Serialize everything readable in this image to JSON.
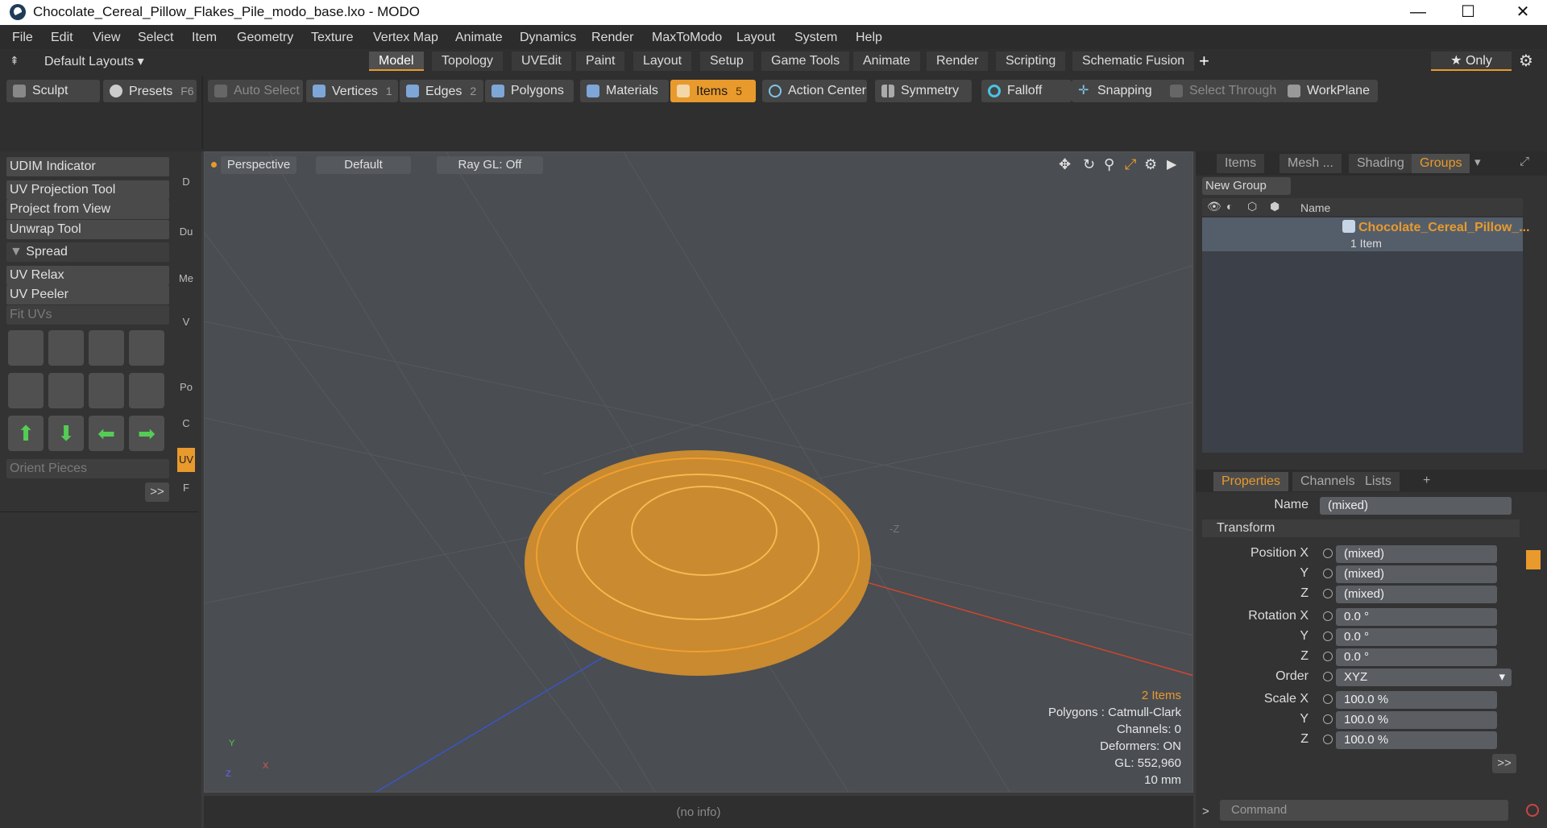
{
  "window": {
    "title": "Chocolate_Cereal_Pillow_Flakes_Pile_modo_base.lxo - MODO",
    "minimize": "—",
    "maximize": "☐",
    "close": "✕"
  },
  "menubar": [
    "File",
    "Edit",
    "View",
    "Select",
    "Item",
    "Geometry",
    "Texture",
    "Vertex Map",
    "Animate",
    "Dynamics",
    "Render",
    "MaxToModo",
    "Layout",
    "System",
    "Help"
  ],
  "layoutbar": {
    "layouts_dropdown": "Default Layouts",
    "tabs": [
      "Model",
      "Topology",
      "UVEdit",
      "Paint",
      "Layout",
      "Setup",
      "Game Tools",
      "Animate",
      "Render",
      "Scripting",
      "Schematic Fusion"
    ],
    "active_tab": "Model",
    "add": "+",
    "only": "★  Only"
  },
  "toolbar": {
    "sculpt": "Sculpt",
    "presets": "Presets",
    "presets_key": "F6",
    "auto_select": "Auto Select",
    "vertices": "Vertices",
    "vertices_count": "1",
    "edges": "Edges",
    "edges_count": "2",
    "polygons": "Polygons",
    "materials": "Materials",
    "items": "Items",
    "items_count": "5",
    "action_center": "Action Center",
    "symmetry": "Symmetry",
    "falloff": "Falloff",
    "snapping": "Snapping",
    "select_through": "Select Through",
    "workplane": "WorkPlane"
  },
  "leftpanel": {
    "buttons": [
      "UDIM Indicator",
      "UV Projection Tool",
      "Project from View",
      "Unwrap Tool"
    ],
    "spread": "Spread",
    "buttons2": [
      "UV Relax",
      "UV Peeler"
    ],
    "fit_uvs": "Fit UVs",
    "orient_pieces": "Orient Pieces",
    "more": ">>",
    "vtabs": [
      "D",
      "Du",
      "Me",
      "V",
      "Po",
      "C",
      "UV",
      "F"
    ]
  },
  "viewport": {
    "view": "Perspective",
    "shading": "Default",
    "raygl": "Ray GL: Off",
    "axis_label": "-Z",
    "info": {
      "items": "2 Items",
      "polygons": "Polygons : Catmull-Clark",
      "channels": "Channels: 0",
      "deformers": "Deformers: ON",
      "gl": "GL: 552,960",
      "scale": "10 mm"
    },
    "gizmo": {
      "y": "Y",
      "x": "X",
      "z": "Z"
    }
  },
  "status": "(no info)",
  "groups_panel": {
    "tabs": [
      "Items",
      "Mesh ...",
      "Shading",
      "Groups"
    ],
    "active_tab": "Groups",
    "new_group": "New Group",
    "col_name": "Name",
    "group_name": "Chocolate_Cereal_Pillow_...",
    "group_count": "1 Item"
  },
  "properties_panel": {
    "tabs": [
      "Properties",
      "Channels",
      "Lists"
    ],
    "active_tab": "Properties",
    "add": "+",
    "name_label": "Name",
    "name_value": "(mixed)",
    "transform": "Transform",
    "rows": [
      {
        "label": "Position X",
        "value": "(mixed)"
      },
      {
        "label": "Y",
        "value": "(mixed)"
      },
      {
        "label": "Z",
        "value": "(mixed)"
      },
      {
        "label": "Rotation X",
        "value": "0.0 °"
      },
      {
        "label": "Y",
        "value": "0.0 °"
      },
      {
        "label": "Z",
        "value": "0.0 °"
      },
      {
        "label": "Order",
        "value": "XYZ"
      },
      {
        "label": "Scale X",
        "value": "100.0 %"
      },
      {
        "label": "Y",
        "value": "100.0 %"
      },
      {
        "label": "Z",
        "value": "100.0 %"
      }
    ],
    "more": ">>"
  },
  "command": {
    "prompt": ">",
    "placeholder": "Command"
  },
  "colors": {
    "accent": "#e89a2c",
    "mesh": "#f0a030",
    "x_axis": "#d2462d",
    "z_axis": "#3a55c8"
  }
}
